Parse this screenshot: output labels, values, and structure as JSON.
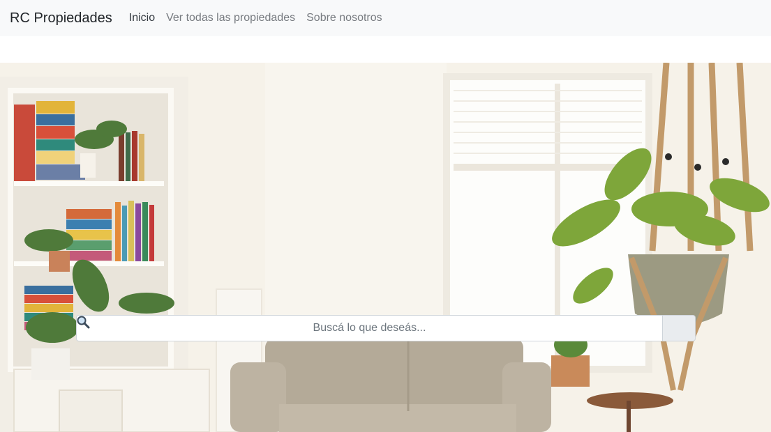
{
  "navbar": {
    "brand": "RC Propiedades",
    "links": [
      {
        "label": "Inicio",
        "active": true
      },
      {
        "label": "Ver todas las propiedades",
        "active": false
      },
      {
        "label": "Sobre nosotros",
        "active": false
      }
    ]
  },
  "hero": {
    "image": "living-room-photo"
  },
  "search": {
    "placeholder": "Buscá lo que deseás...",
    "value": "",
    "button_icon": "magnifier-icon"
  },
  "colors": {
    "navbar_bg": "#f8f9fa",
    "nav_active": "#343a40",
    "nav_inactive": "#777b80",
    "search_button_bg": "#e9ecef"
  }
}
